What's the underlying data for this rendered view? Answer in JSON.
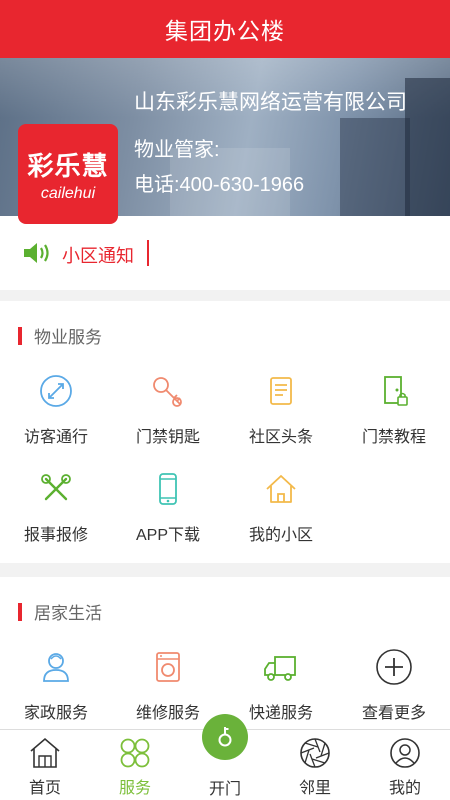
{
  "header": {
    "title": "集团办公楼"
  },
  "banner": {
    "company": "山东彩乐慧网络运营有限公司",
    "manager": "物业管家:",
    "phone": "电话:400-630-1966",
    "logo_cn": "彩乐慧",
    "logo_en": "cailehui"
  },
  "notice": {
    "label": "小区通知"
  },
  "property_services": {
    "title": "物业服务",
    "items": [
      {
        "label": "访客通行",
        "icon": "visitor-pass-icon"
      },
      {
        "label": "门禁钥匙",
        "icon": "key-icon"
      },
      {
        "label": "社区头条",
        "icon": "news-icon"
      },
      {
        "label": "门禁教程",
        "icon": "door-tutorial-icon"
      },
      {
        "label": "报事报修",
        "icon": "repair-tools-icon"
      },
      {
        "label": "APP下载",
        "icon": "phone-download-icon"
      },
      {
        "label": "我的小区",
        "icon": "home-icon"
      }
    ]
  },
  "home_life": {
    "title": "居家生活",
    "items": [
      {
        "label": "家政服务",
        "icon": "housekeeping-icon"
      },
      {
        "label": "维修服务",
        "icon": "washing-machine-icon"
      },
      {
        "label": "快递服务",
        "icon": "delivery-truck-icon"
      },
      {
        "label": "查看更多",
        "icon": "plus-circle-icon"
      }
    ]
  },
  "tabbar": {
    "home": "首页",
    "services": "服务",
    "open": "开门",
    "neighbors": "邻里",
    "mine": "我的"
  },
  "colors": {
    "brand_red": "#e8262f",
    "active_green": "#7cbf3a",
    "open_green": "#6ab23a"
  }
}
